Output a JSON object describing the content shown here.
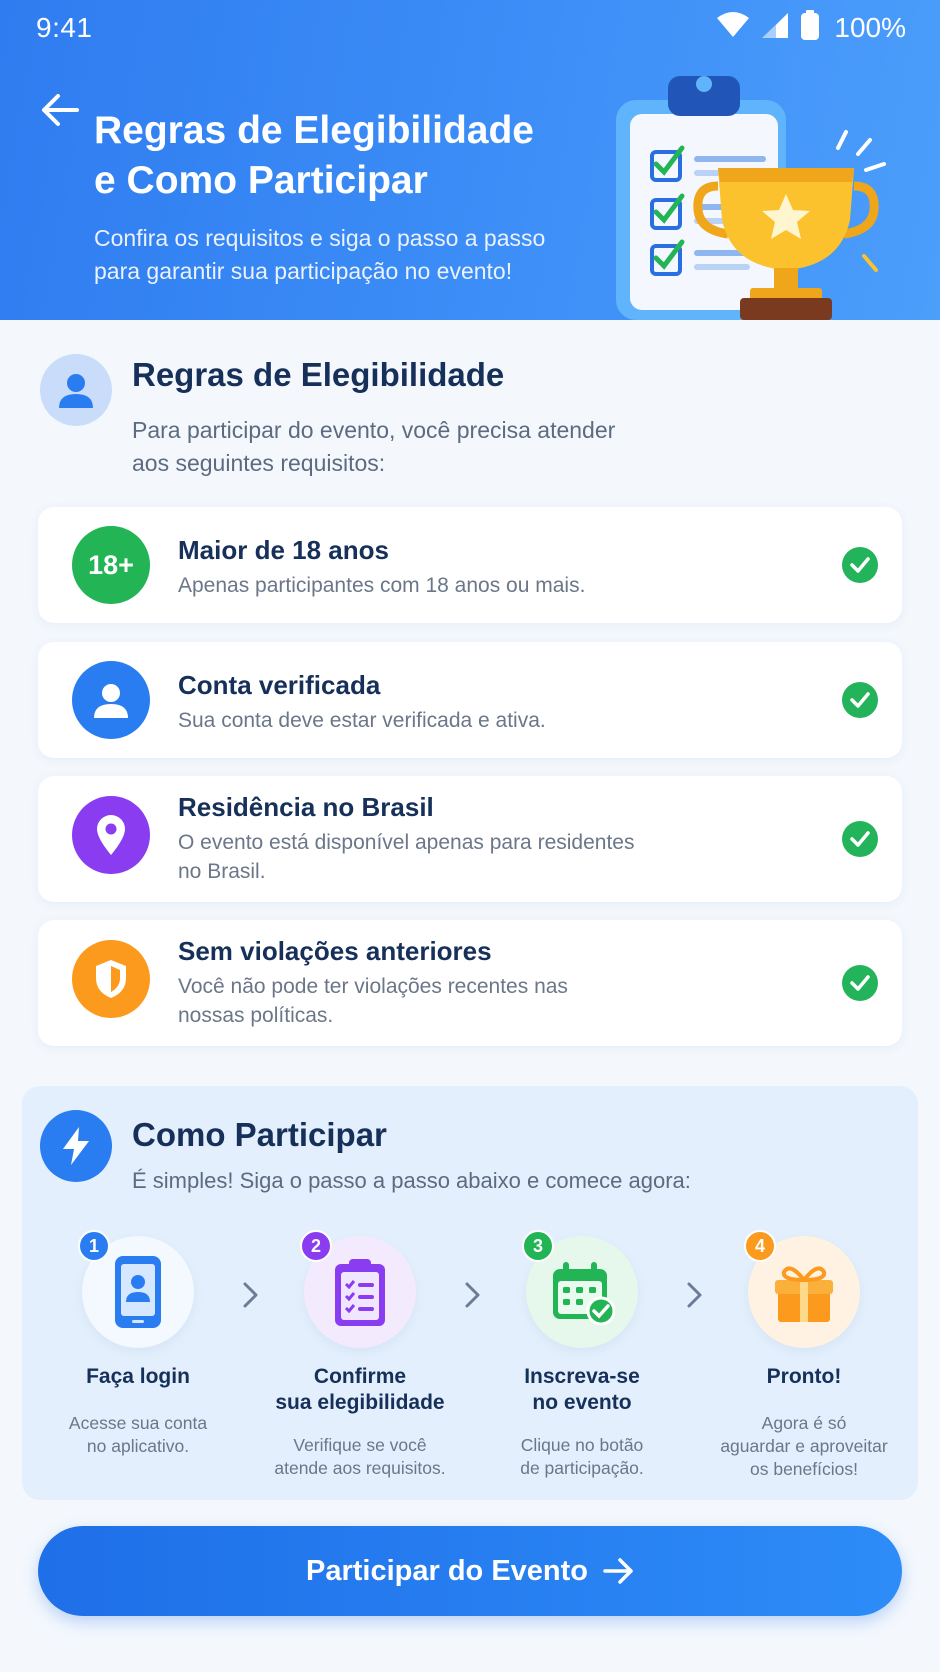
{
  "status_bar": {
    "time": "9:41",
    "battery": "100%"
  },
  "header": {
    "title_line1": "Regras de Elegibilidade",
    "title_line2": "e Como Participar",
    "subtitle_line1": "Confira os requisitos e siga o passo a passo",
    "subtitle_line2": "para garantir sua participação no evento!"
  },
  "eligibility": {
    "title": "Regras de Elegibilidade",
    "desc_line1": "Para participar do evento, você precisa atender",
    "desc_line2": "aos seguintes requisitos:",
    "items": [
      {
        "badge": "18+",
        "title": "Maior de 18 anos",
        "desc_line1": "Apenas participantes com 18 anos ou mais.",
        "desc_line2": "",
        "icon": "age-18-icon",
        "color": "#22b455"
      },
      {
        "title": "Conta verificada",
        "desc_line1": "Sua conta deve estar verificada e ativa.",
        "desc_line2": "",
        "icon": "user-icon",
        "color": "#2a7df1"
      },
      {
        "title": "Residência no Brasil",
        "desc_line1": "O evento está disponível apenas para residentes",
        "desc_line2": "no Brasil.",
        "icon": "location-pin-icon",
        "color": "#8a3df0"
      },
      {
        "title": "Sem violações anteriores",
        "desc_line1": "Você não pode ter violações recentes nas",
        "desc_line2": "nossas políticas.",
        "icon": "shield-icon",
        "color": "#fb9a1c"
      }
    ]
  },
  "how": {
    "title": "Como Participar",
    "desc": "É simples! Siga o passo a passo abaixo e comece agora:",
    "steps": [
      {
        "num": "1",
        "title_line1": "Faça login",
        "title_line2": "",
        "desc_line1": "Acesse sua conta",
        "desc_line2": "no aplicativo.",
        "desc_line3": "",
        "icon": "phone-login-icon",
        "color": "#2a7df1"
      },
      {
        "num": "2",
        "title_line1": "Confirme",
        "title_line2": "sua elegibilidade",
        "desc_line1": "Verifique se você",
        "desc_line2": "atende aos requisitos.",
        "desc_line3": "",
        "icon": "clipboard-checklist-icon",
        "color": "#8a3df0"
      },
      {
        "num": "3",
        "title_line1": "Inscreva-se",
        "title_line2": "no evento",
        "desc_line1": "Clique no botão",
        "desc_line2": "de participação.",
        "desc_line3": "",
        "icon": "calendar-check-icon",
        "color": "#22b455"
      },
      {
        "num": "4",
        "title_line1": "Pronto!",
        "title_line2": "",
        "desc_line1": "Agora é só",
        "desc_line2": "aguardar e aproveitar",
        "desc_line3": "os benefícios!",
        "icon": "gift-icon",
        "color": "#fb9a1c"
      }
    ]
  },
  "cta": {
    "label": "Participar do Evento"
  }
}
